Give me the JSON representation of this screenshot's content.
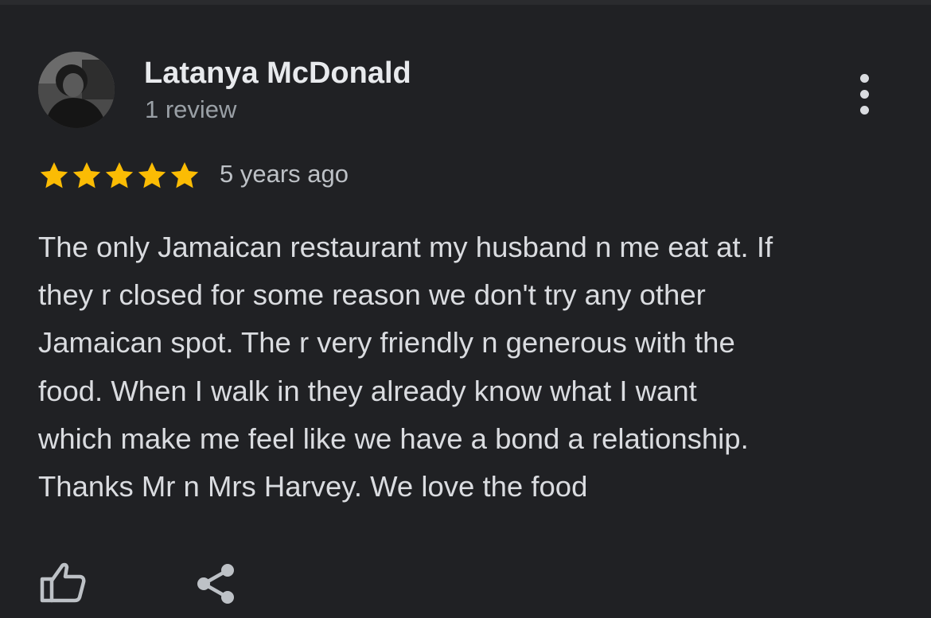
{
  "review": {
    "author_name": "Latanya McDonald",
    "review_count": "1 review",
    "rating": 5,
    "max_rating": 5,
    "date": "5 years ago",
    "text": "The only Jamaican restaurant my husband n me eat at. If\nthey r closed for some reason we don't try any other\nJamaican spot. The r very friendly n generous with the\nfood. When I walk in they already know what I want\nwhich make me feel like we have a bond a relationship.\nThanks Mr n Mrs Harvey. We love the food"
  },
  "actions": {
    "more_icon": "more-vert-icon",
    "like_icon": "thumbs-up-icon",
    "share_icon": "share-icon"
  },
  "colors": {
    "background": "#202124",
    "star": "#fbbc04",
    "name": "#e8eaed",
    "secondary_text": "#9aa0a6",
    "body_text": "#dadce0"
  }
}
